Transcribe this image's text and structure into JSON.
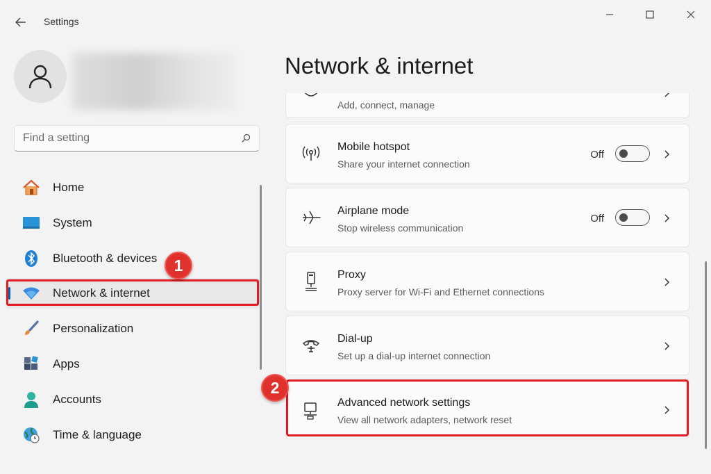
{
  "window": {
    "title": "Settings"
  },
  "search": {
    "placeholder": "Find a setting"
  },
  "sidebar": {
    "items": [
      {
        "label": "Home",
        "icon": "home-icon"
      },
      {
        "label": "System",
        "icon": "monitor-icon"
      },
      {
        "label": "Bluetooth & devices",
        "icon": "bluetooth-icon"
      },
      {
        "label": "Network & internet",
        "icon": "wifi-icon",
        "active": true
      },
      {
        "label": "Personalization",
        "icon": "paintbrush-icon"
      },
      {
        "label": "Apps",
        "icon": "apps-icon"
      },
      {
        "label": "Accounts",
        "icon": "person-icon"
      },
      {
        "label": "Time & language",
        "icon": "globe-clock-icon"
      }
    ]
  },
  "main": {
    "title": "Network & internet",
    "cards": [
      {
        "title": "",
        "subtitle": "Add, connect, manage",
        "icon": "network-icon"
      },
      {
        "title": "Mobile hotspot",
        "subtitle": "Share your internet connection",
        "icon": "hotspot-icon",
        "toggle_label": "Off",
        "toggle_on": false
      },
      {
        "title": "Airplane mode",
        "subtitle": "Stop wireless communication",
        "icon": "airplane-icon",
        "toggle_label": "Off",
        "toggle_on": false
      },
      {
        "title": "Proxy",
        "subtitle": "Proxy server for Wi-Fi and Ethernet connections",
        "icon": "proxy-icon"
      },
      {
        "title": "Dial-up",
        "subtitle": "Set up a dial-up internet connection",
        "icon": "phone-icon"
      },
      {
        "title": "Advanced network settings",
        "subtitle": "View all network adapters, network reset",
        "icon": "advanced-network-icon"
      }
    ]
  },
  "annotations": {
    "step1": "1",
    "step2": "2"
  },
  "colors": {
    "accent": "#0067c0",
    "highlight": "#e01a22"
  }
}
